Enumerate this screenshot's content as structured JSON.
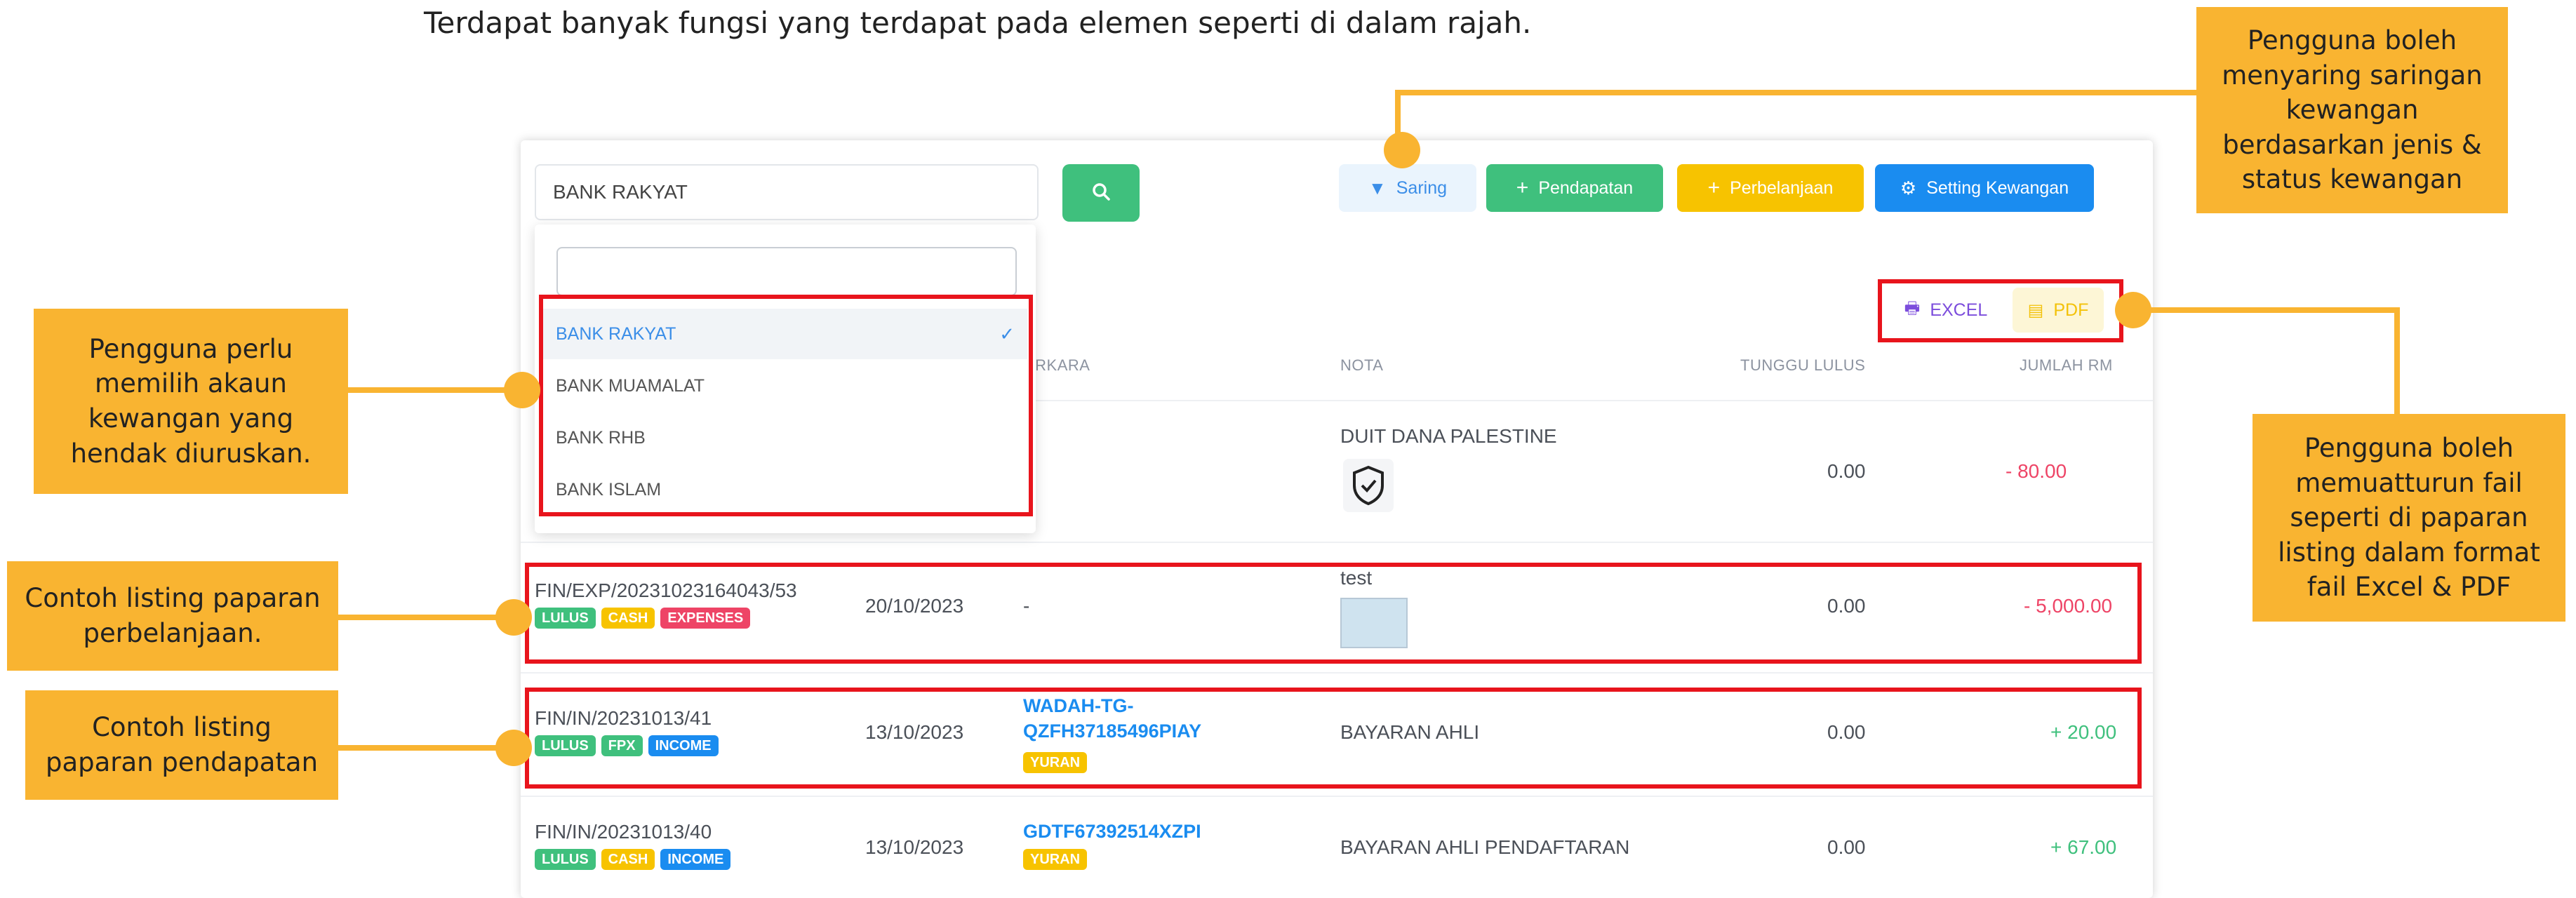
{
  "heading": "Terdapat banyak fungsi yang terdapat pada elemen seperti di dalam rajah.",
  "account_select": {
    "value": "BANK RAKYAT",
    "options": [
      "BANK RAKYAT",
      "BANK MUAMALAT",
      "BANK RHB",
      "BANK ISLAM"
    ]
  },
  "toolbar": {
    "filter_label": "Saring",
    "income_label": "Pendapatan",
    "expense_label": "Perbelanjaan",
    "settings_label": "Setting Kewangan",
    "excel_label": "EXCEL",
    "pdf_label": "PDF"
  },
  "table": {
    "columns": {
      "perkara_partial": "ERKARA",
      "nota": "NOTA",
      "pending": "TUNGGU LULUS",
      "amount": "JUMLAH RM"
    },
    "rows": [
      {
        "id": "",
        "date": "",
        "perkara": "",
        "perkara_tag": "",
        "nota": "DUIT DANA PALESTINE",
        "pending": "0.00",
        "amount": "- 80.00",
        "badges": []
      },
      {
        "id": "FIN/EXP/20231023164043/53",
        "date": "20/10/2023",
        "perkara": "-",
        "perkara_tag": "",
        "nota": "test",
        "pending": "0.00",
        "amount": "- 5,000.00",
        "badges": [
          "LULUS",
          "CASH",
          "EXPENSES"
        ]
      },
      {
        "id": "FIN/IN/20231013/41",
        "date": "13/10/2023",
        "perkara": "WADAH-TG-\nQZFH37185496PIAY",
        "perkara_tag": "YURAN",
        "nota": "BAYARAN AHLI",
        "pending": "0.00",
        "amount": "+ 20.00",
        "badges": [
          "LULUS",
          "FPX",
          "INCOME"
        ]
      },
      {
        "id": "FIN/IN/20231013/40",
        "date": "13/10/2023",
        "perkara": "GDTF67392514XZPI",
        "perkara_tag": "YURAN",
        "nota": "BAYARAN AHLI PENDAFTARAN",
        "pending": "0.00",
        "amount": "+ 67.00",
        "badges": [
          "LULUS",
          "CASH",
          "INCOME"
        ]
      }
    ]
  },
  "callouts": {
    "filter": "Pengguna boleh menyaring saringan kewangan berdasarkan jenis & status kewangan",
    "account": "Pengguna perlu memilih akaun kewangan yang hendak diuruskan.",
    "expense_example": "Contoh listing paparan perbelanjaan.",
    "income_example": "Contoh listing paparan pendapatan",
    "export": "Pengguna boleh memuatturun fail seperti di paparan listing dalam format fail Excel & PDF"
  },
  "colors": {
    "accent_orange": "#f9b431",
    "highlight_red": "#e8141c",
    "negative": "#ee4466",
    "positive": "#3fc07d",
    "link_blue": "#1a8cf0"
  }
}
